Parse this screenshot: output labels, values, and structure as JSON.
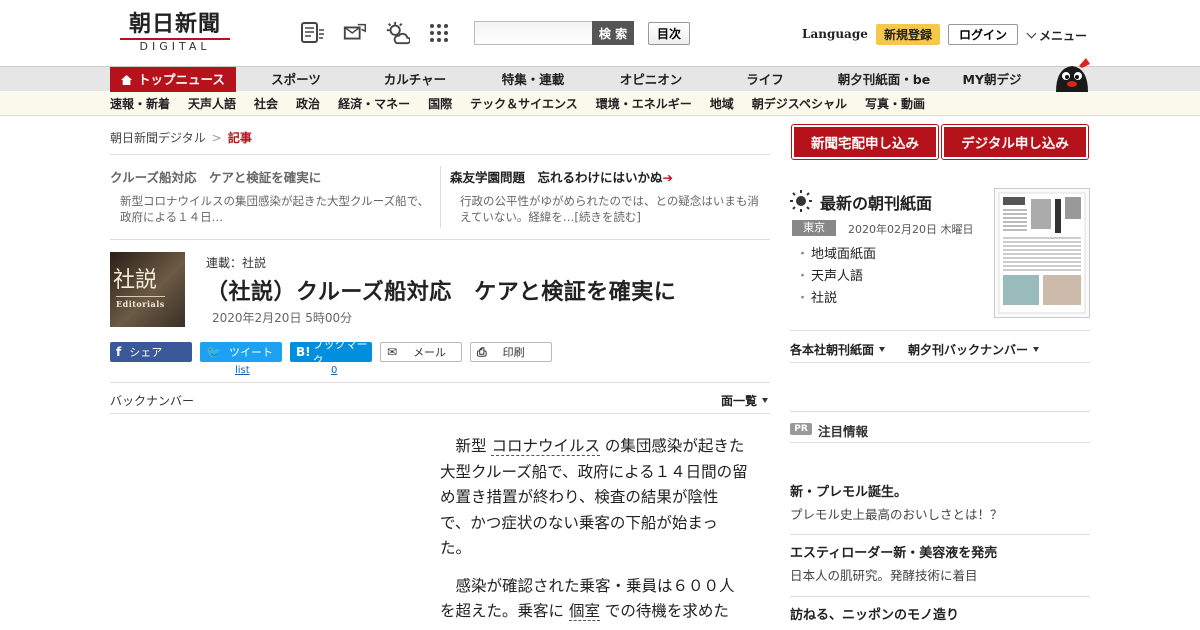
{
  "header": {
    "logo_jp": "朝日新聞",
    "logo_en": "DIGITAL",
    "search_placeholder": "",
    "search_button": "検 索",
    "mokuji": "目次",
    "language": "Language",
    "signup": "新規登録",
    "login": "ログイン",
    "menu": "メニュー"
  },
  "nav_main": [
    "トップニュース",
    "スポーツ",
    "カルチャー",
    "特集・連載",
    "オピニオン",
    "ライフ",
    "朝夕刊紙面・be",
    "MY朝デジ"
  ],
  "nav_sub": [
    "速報・新着",
    "天声人語",
    "社会",
    "政治",
    "経済・マネー",
    "国際",
    "テック＆サイエンス",
    "環境・エネルギー",
    "地域",
    "朝デジスペシャル",
    "写真・動画"
  ],
  "breadcrumb": {
    "home": "朝日新聞デジタル",
    "sep": ">",
    "current": "記事"
  },
  "related": {
    "left": {
      "title": "クルーズ船対応　ケアと検証を確実に",
      "desc": "新型コロナウイルスの集団感染が起きた大型クルーズ船で、政府による１４日…"
    },
    "right": {
      "title": "森友学園問題　忘れるわけにはいかぬ",
      "arrow": "➔",
      "desc": "行政の公平性がゆがめられたのでは、との疑念はいまも消えていない。経緯を…[続きを読む]"
    }
  },
  "article": {
    "badge_kanji": "社説",
    "badge_en": "Editorials",
    "series": "連載：社説",
    "title": "（社説）クルーズ船対応　ケアと検証を確実に",
    "date": "2020年2月20日 5時00分",
    "p1_a": "新型",
    "p1_link": "コロナウイルス",
    "p1_b": "の集団感染が起きた大型クルーズ船で、政府による１４日間の留め置き措置が終わり、検査の結果が陰性で、かつ症状のない乗客の下船が始まった。",
    "p2_a": "感染が確認された乗客・乗員は６００人を超えた。乗客に",
    "p2_link": "個室",
    "p2_b": "での待機を求めた"
  },
  "share": {
    "fb_icon": "f",
    "fb": "シェア",
    "tw_icon": "🐦",
    "tw": "ツイート",
    "tw_count": "list",
    "hb_icon": "B!",
    "hb": "ブックマーク",
    "hb_count": "0",
    "ml_icon": "✉",
    "ml": "メール",
    "pr_icon": "⎙",
    "pr": "印刷"
  },
  "backnumber": {
    "label": "バックナンバー",
    "list": "面一覧"
  },
  "right": {
    "btn1": "新聞宅配申し込み",
    "btn2": "デジタル申し込み",
    "morning_title": "最新の朝刊紙面",
    "region": "東京",
    "paper_date": "2020年02月20日 木曜日",
    "links": [
      "地域面紙面",
      "天声人語",
      "社説"
    ],
    "drop1": "各本社朝刊紙面",
    "drop2": "朝夕刊バックナンバー",
    "pr_badge": "PR",
    "attention": "注目情報",
    "ads": [
      {
        "title": "新・プレモル誕生。",
        "sub": "プレモル史上最高のおいしさとは！？"
      },
      {
        "title": "エスティローダー新・美容液を発売",
        "sub": "日本人の肌研究。発酵技術に着目"
      },
      {
        "title": "訪ねる、ニッポンのモノ造り",
        "sub": ""
      }
    ]
  },
  "colors": {
    "brand_red": "#b5121b",
    "signup_yellow": "#f5c84c",
    "facebook": "#3b5998",
    "twitter": "#1da1f2",
    "hatena": "#008fde"
  }
}
